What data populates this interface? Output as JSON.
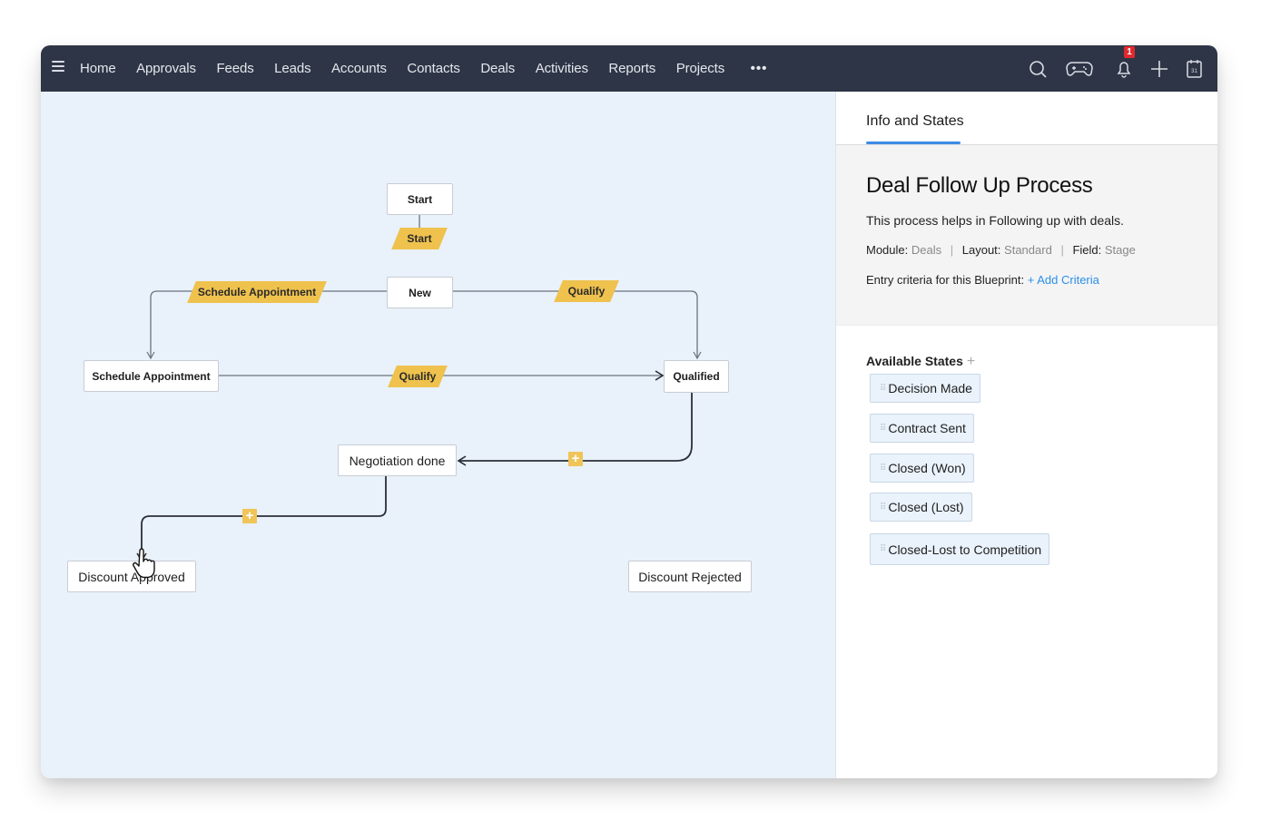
{
  "topbar": {
    "nav": [
      "Home",
      "Approvals",
      "Feeds",
      "Leads",
      "Accounts",
      "Contacts",
      "Deals",
      "Activities",
      "Reports",
      "Projects"
    ],
    "more_label": "•••",
    "icons": [
      "search-icon",
      "gamepad-icon",
      "bell-icon",
      "plus-icon",
      "calendar-icon",
      "tools-icon"
    ],
    "notification_count": "1",
    "calendar_day": "31"
  },
  "canvas": {
    "nodes": {
      "start": "Start",
      "new": "New",
      "schedule": "Schedule Appointment",
      "qualified": "Qualified",
      "negotiation": "Negotiation done",
      "approved": "Discount Approved",
      "rejected": "Discount Rejected"
    },
    "transitions": {
      "start": "Start",
      "schedule": "Schedule Appointment",
      "qualify_top": "Qualify",
      "qualify_mid": "Qualify"
    },
    "add_transition_label": "+"
  },
  "panel": {
    "tab": "Info and States",
    "title": "Deal Follow Up Process",
    "description": "This process helps in Following up with deals.",
    "module_label": "Module:",
    "module_value": "Deals",
    "layout_label": "Layout:",
    "layout_value": "Standard",
    "field_label": "Field:",
    "field_value": "Stage",
    "separator": "|",
    "entry_label": "Entry criteria for this Blueprint:",
    "add_criteria": "+ Add Criteria",
    "states_title": "Available States",
    "states_add": "+",
    "grip": "⠿",
    "states": [
      "Decision Made",
      "Contract Sent",
      "Closed (Won)",
      "Closed (Lost)",
      "Closed-Lost to Competition"
    ]
  },
  "colors": {
    "topbar": "#2e3546",
    "canvas": "#e9f1fa",
    "transition": "#efc24e",
    "accent": "#3d8be3",
    "link": "#2b8ee8",
    "badge": "#e0292e"
  }
}
